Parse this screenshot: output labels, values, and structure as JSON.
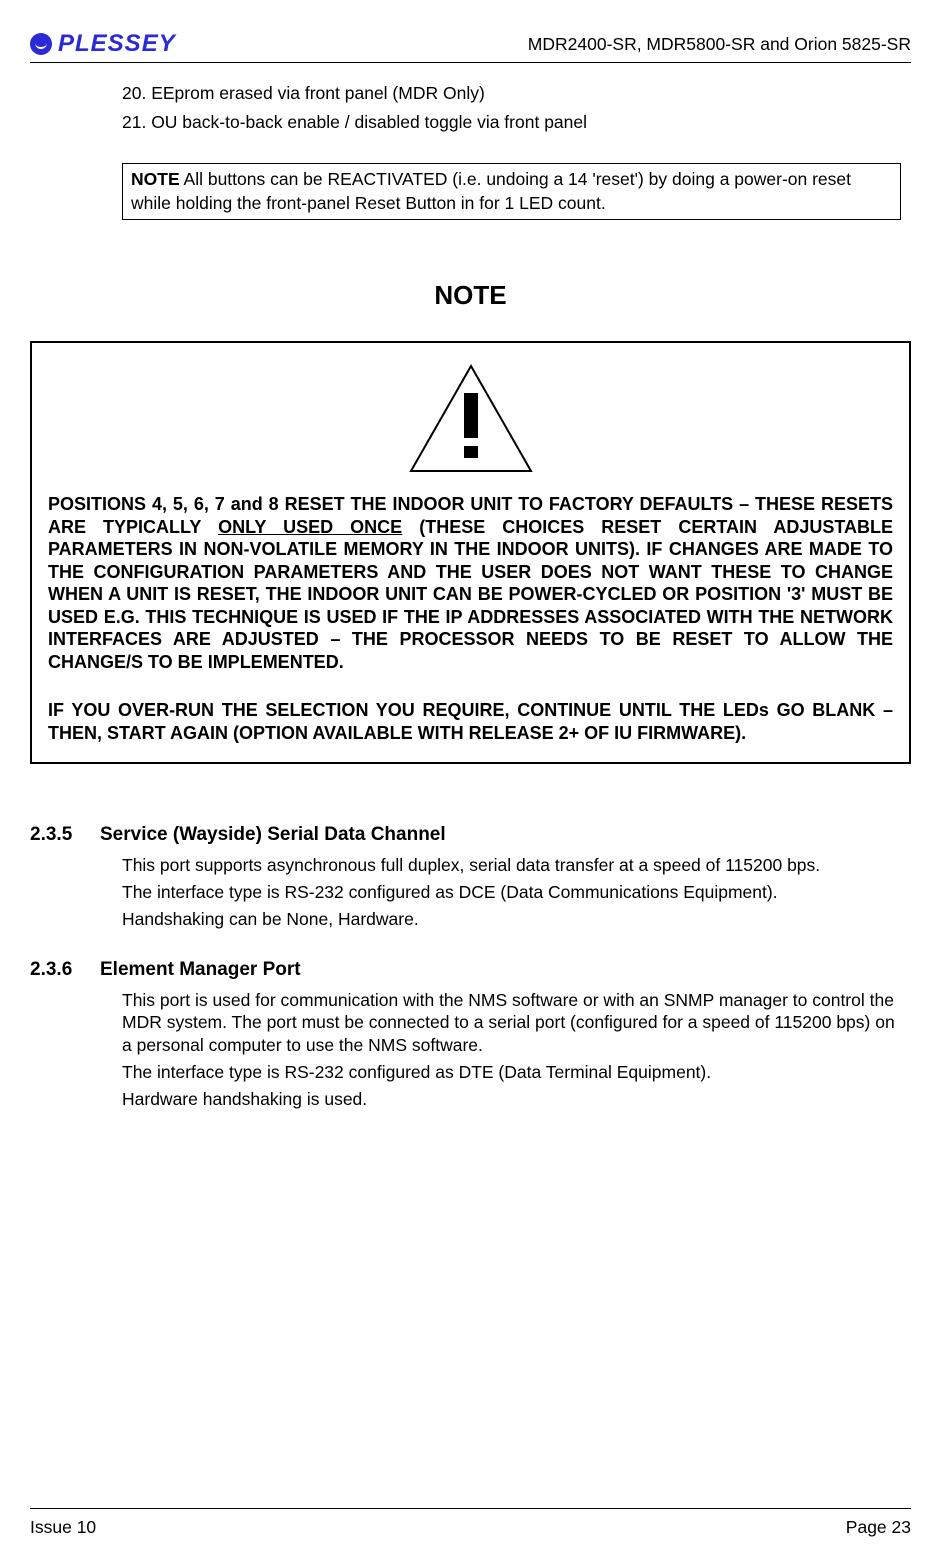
{
  "header": {
    "logo_text": "PLESSEY",
    "doc_title": "MDR2400-SR, MDR5800-SR and Orion 5825-SR"
  },
  "list": {
    "item20": "20. EEprom erased via front panel (MDR Only)",
    "item21": "21. OU back-to-back enable / disabled toggle via front panel"
  },
  "notebox": {
    "bold": "NOTE",
    "text": " All buttons can be REACTIVATED (i.e. undoing a 14 'reset') by doing a power-on reset while holding the front-panel Reset Button in for 1 LED count."
  },
  "big_note": "NOTE",
  "caution": {
    "p1_a": "POSITIONS 4, 5, 6, 7 and 8 RESET THE INDOOR UNIT TO FACTORY DEFAULTS – THESE RESETS ARE TYPICALLY ",
    "p1_u": "ONLY USED ONCE",
    "p1_b": " (THESE CHOICES RESET CERTAIN ADJUSTABLE PARAMETERS IN NON-VOLATILE MEMORY IN THE INDOOR UNITS).  IF CHANGES ARE MADE TO THE CONFIGURATION PARAMETERS AND THE USER DOES NOT WANT THESE TO CHANGE WHEN A UNIT IS RESET, THE INDOOR UNIT CAN BE POWER-CYCLED OR POSITION '3' MUST BE USED E.G. THIS TECHNIQUE IS USED IF THE IP ADDRESSES ASSOCIATED WITH THE NETWORK INTERFACES ARE ADJUSTED – THE PROCESSOR NEEDS TO BE RESET TO ALLOW THE CHANGE/S TO BE IMPLEMENTED.",
    "p2": "IF YOU OVER-RUN THE SELECTION YOU REQUIRE, CONTINUE UNTIL THE LEDs GO BLANK – THEN, START AGAIN (OPTION AVAILABLE WITH RELEASE 2+ OF IU FIRMWARE)."
  },
  "section235": {
    "num": "2.3.5",
    "title": "Service (Wayside) Serial Data Channel",
    "p1": "This port supports asynchronous full duplex, serial data transfer at a speed of 115200 bps.",
    "p2": "The interface type is RS-232 configured as DCE (Data Communications Equipment).",
    "p3": "Handshaking can be None, Hardware."
  },
  "section236": {
    "num": "2.3.6",
    "title": "Element Manager Port",
    "p1": "This port is used for communication with the NMS software or with an SNMP manager to control the MDR system.  The port must be connected to a serial port (configured for a speed of 115200 bps) on a personal computer to use the NMS software.",
    "p2": "The interface type is RS-232 configured as DTE (Data Terminal Equipment).",
    "p3": "Hardware handshaking is used."
  },
  "footer": {
    "left": "Issue 10",
    "right": "Page 23"
  }
}
